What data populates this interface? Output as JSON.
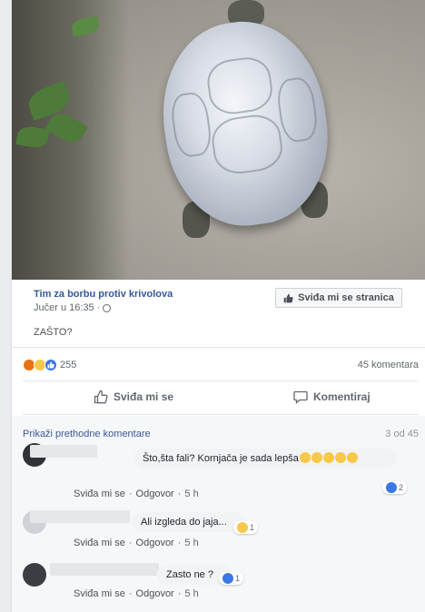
{
  "post": {
    "page_name": "Tim za borbu protiv krivolova",
    "time": "Jučer u 16:35 ·",
    "text": "ZAŠTO?",
    "like_page_label": "Sviđa mi se stranica"
  },
  "stats": {
    "reaction_count": "255",
    "comment_count": "45 komentara"
  },
  "actions": {
    "like_label": "Sviđa mi se",
    "comment_label": "Komentiraj"
  },
  "comments_section": {
    "previous_link": "Prikaži prethodne komentare",
    "pager": "3 od 45",
    "items": [
      {
        "text": "Što,šta fali? Kornjača je sada lepša",
        "like": "Sviđa mi se",
        "reply": "Odgovor",
        "time": "5 h",
        "reaction_count": "2"
      },
      {
        "text": "Ali izgleda do jaja...",
        "like": "Sviđa mi se",
        "reply": "Odgovor",
        "time": "5 h",
        "reaction_count": "1"
      },
      {
        "text": "Zasto ne ?",
        "like": "Sviđa mi se",
        "reply": "Odgovor",
        "time": "5 h",
        "reaction_count": "1"
      }
    ]
  },
  "colors": {
    "link_blue": "#365899",
    "like_blue": "#3b78e7",
    "angry_orange": "#e9710f",
    "emoji_yellow": "#f7c84a"
  }
}
